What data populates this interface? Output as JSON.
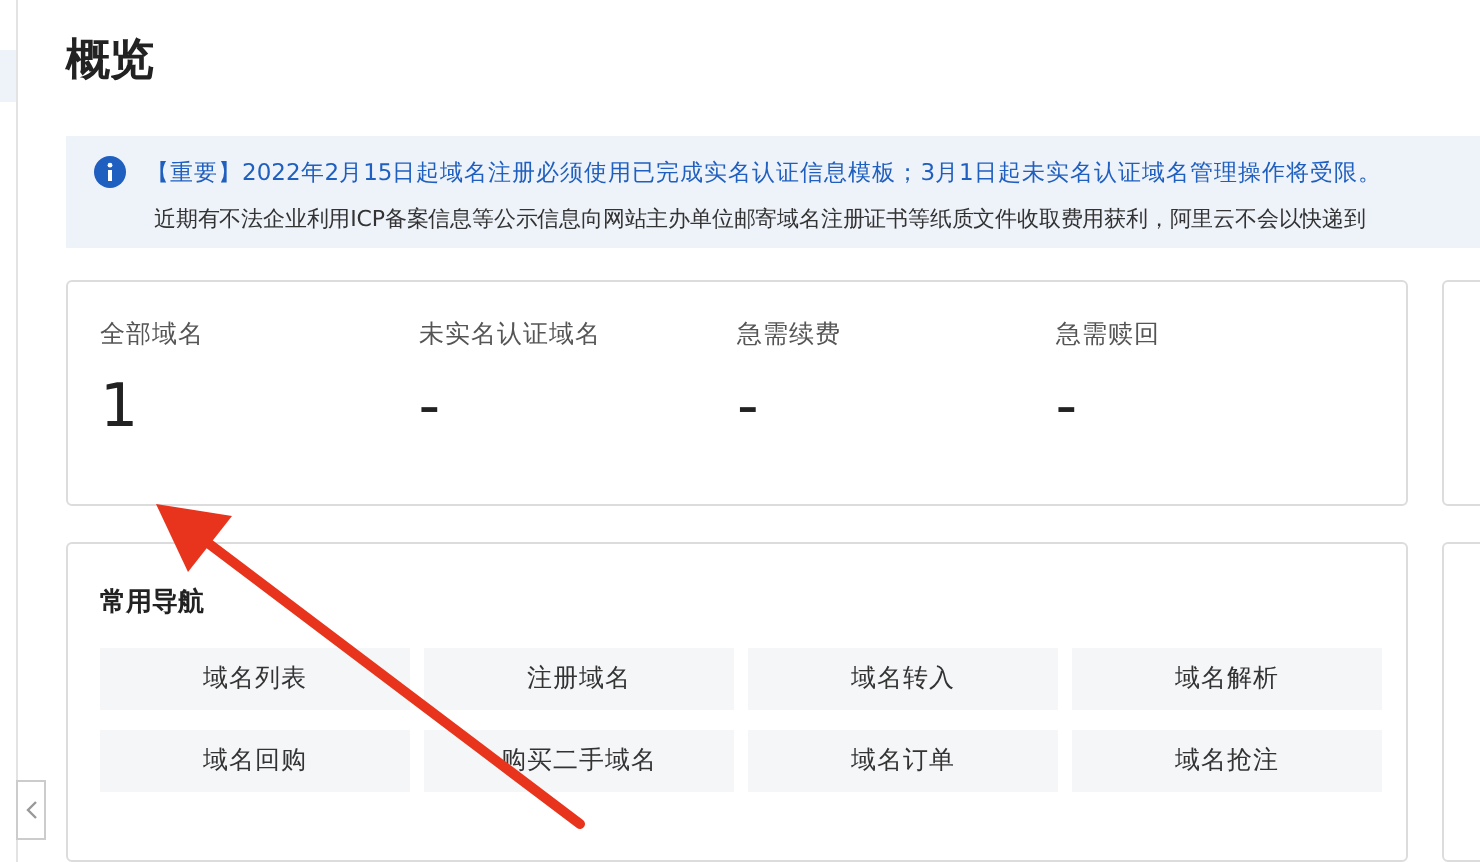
{
  "page": {
    "title": "概览"
  },
  "notice": {
    "headline": "【重要】2022年2月15日起域名注册必须使用已完成实名认证信息模板；3月1日起未实名认证域名管理操作将受限。",
    "body": "近期有不法企业利用ICP备案信息等公示信息向网站主办单位邮寄域名注册证书等纸质文件收取费用获利，阿里云不会以快递到"
  },
  "stats": [
    {
      "label": "全部域名",
      "value": "1"
    },
    {
      "label": "未实名认证域名",
      "value": "-"
    },
    {
      "label": "急需续费",
      "value": "-"
    },
    {
      "label": "急需赎回",
      "value": "-"
    }
  ],
  "navigation": {
    "title": "常用导航",
    "links": [
      "域名列表",
      "注册域名",
      "域名转入",
      "域名解析",
      "域名回购",
      "购买二手域名",
      "域名订单",
      "域名抢注"
    ]
  }
}
